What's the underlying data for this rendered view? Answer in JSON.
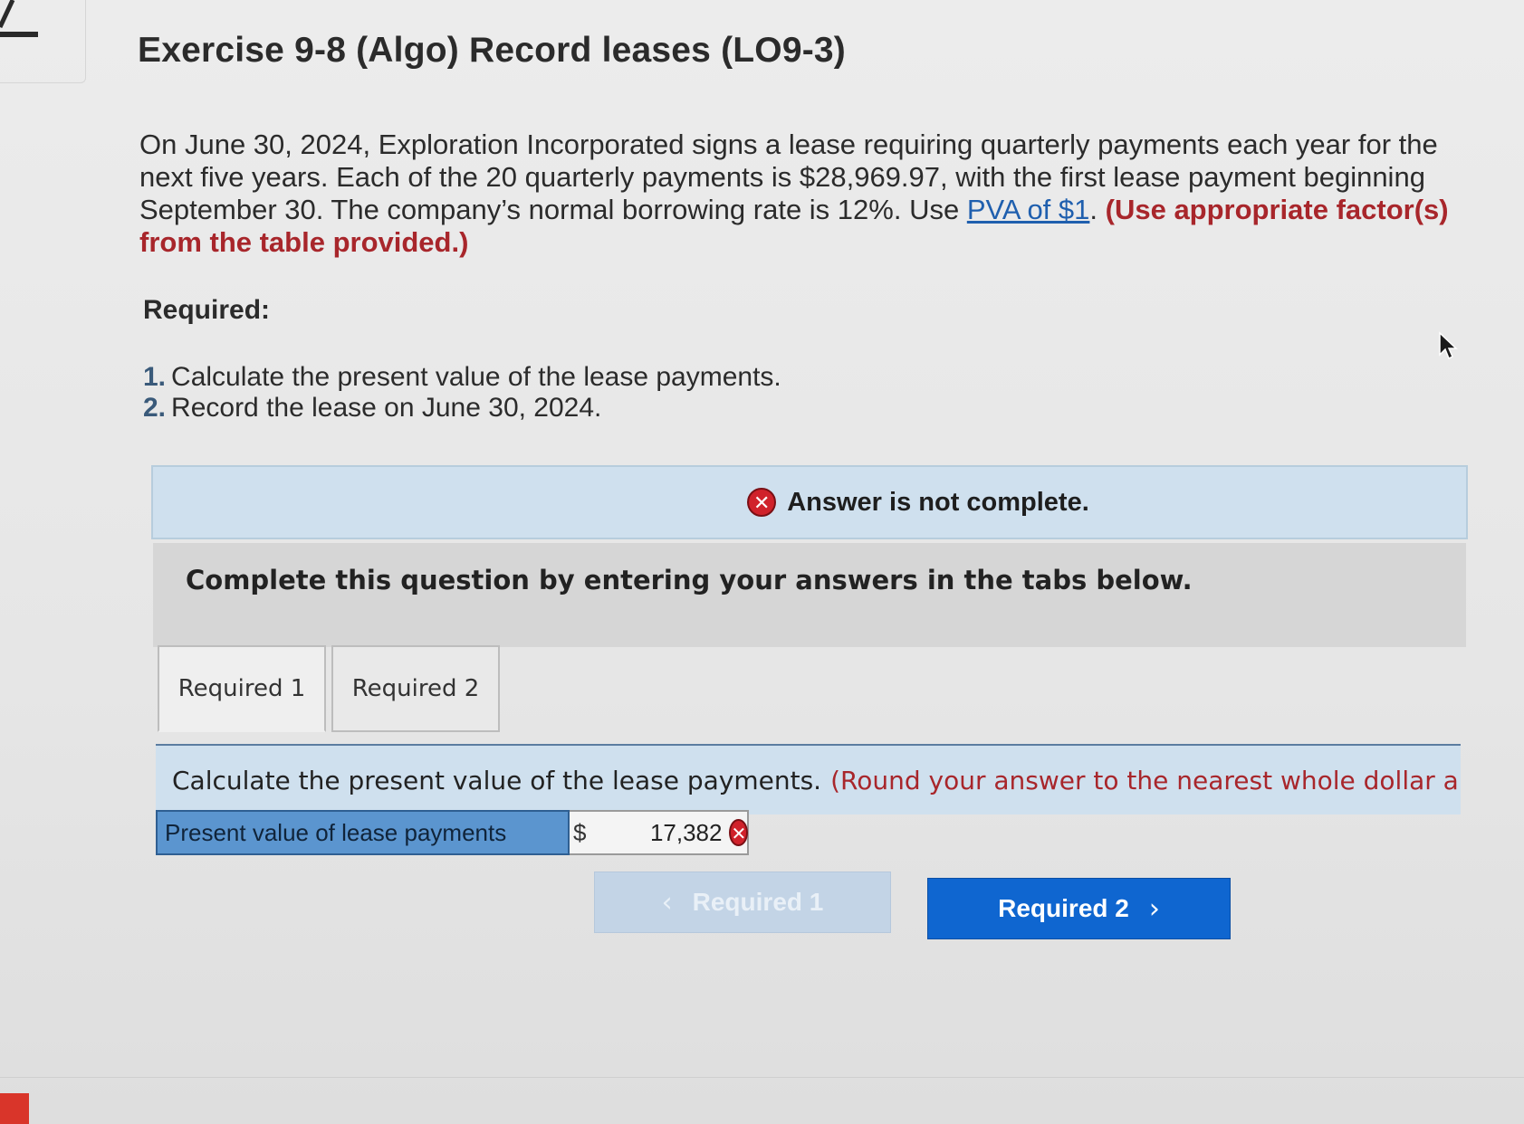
{
  "exercise": {
    "title": "Exercise 9-8 (Algo) Record leases (LO9-3)"
  },
  "intro": {
    "text_before_link": "On June 30, 2024, Exploration Incorporated signs a lease requiring quarterly payments each year for the next five years. Each of the 20 quarterly payments is $28,969.97, with the first lease payment beginning September 30. The company’s normal borrowing rate is 12%. Use ",
    "link_label": "PVA of $1",
    "text_after_link": ". ",
    "hint": "(Use appropriate factor(s) from the table provided.)"
  },
  "required": {
    "heading": "Required:",
    "items": [
      {
        "number": "1.",
        "text": "Calculate the present value of the lease payments."
      },
      {
        "number": "2.",
        "text": "Record the lease on June 30, 2024."
      }
    ]
  },
  "status": {
    "message": "Answer is not complete.",
    "icon": "x-circle-icon",
    "icon_glyph": "✕",
    "color": "#d0222b"
  },
  "instruction": "Complete this question by entering your answers in the tabs below.",
  "tabs": [
    {
      "label": "Required 1",
      "active": true
    },
    {
      "label": "Required 2",
      "active": false
    }
  ],
  "question": {
    "main": "Calculate the present value of the lease payments.",
    "note": "(Round your answer to the nearest whole dollar amount"
  },
  "answer": {
    "label": "Present value of lease payments",
    "currency": "$",
    "value": "17,382",
    "status_glyph": "✕"
  },
  "navigation": {
    "prev_label": "Required 1",
    "next_label": "Required 2",
    "prev_glyph": "‹",
    "next_glyph": "›"
  },
  "colors": {
    "link": "#1f5fae",
    "hint": "#a8262b",
    "next_button": "#0f66d0",
    "banner": "#cfe0ee"
  }
}
